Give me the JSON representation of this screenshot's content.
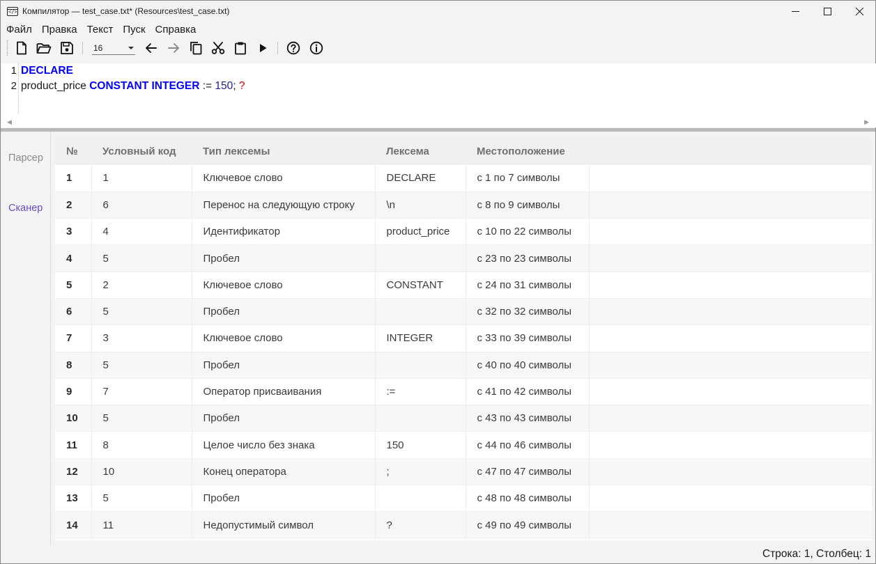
{
  "window": {
    "title": "Компилятор — test_case.txt* (Resources\\test_case.txt)"
  },
  "menu": [
    "Файл",
    "Правка",
    "Текст",
    "Пуск",
    "Справка"
  ],
  "toolbar": {
    "font_size": "16",
    "icons": [
      "new-file-icon",
      "open-folder-icon",
      "save-icon",
      "undo-arrow-icon",
      "redo-arrow-icon",
      "copy-icon",
      "cut-icon",
      "paste-icon",
      "run-icon",
      "help-icon",
      "info-icon"
    ]
  },
  "editor": {
    "line_numbers": [
      "1",
      "2"
    ],
    "line1": {
      "kw": "DECLARE"
    },
    "line2": {
      "ident": "product_price ",
      "kw": "CONSTANT INTEGER",
      "op": " := ",
      "num": "150",
      "semi": "; ",
      "bad": "?"
    }
  },
  "sidetabs": {
    "parser": "Парсер",
    "scanner": "Сканер"
  },
  "table": {
    "headers": [
      "№",
      "Условный код",
      "Тип лексемы",
      "Лексема",
      "Местоположение"
    ],
    "rows": [
      [
        "1",
        "1",
        "Ключевое слово",
        "DECLARE",
        "с 1 по 7 символы"
      ],
      [
        "2",
        "6",
        "Перенос на следующую строку",
        "\\n",
        "с 8 по 9 символы"
      ],
      [
        "3",
        "4",
        "Идентификатор",
        "product_price",
        "с 10 по 22 символы"
      ],
      [
        "4",
        "5",
        "Пробел",
        "",
        "с 23 по 23 символы"
      ],
      [
        "5",
        "2",
        "Ключевое слово",
        "CONSTANT",
        "с 24 по 31 символы"
      ],
      [
        "6",
        "5",
        "Пробел",
        "",
        "с 32 по 32 символы"
      ],
      [
        "7",
        "3",
        "Ключевое слово",
        "INTEGER",
        "с 33 по 39 символы"
      ],
      [
        "8",
        "5",
        "Пробел",
        "",
        "с 40 по 40 символы"
      ],
      [
        "9",
        "7",
        "Оператор присваивания",
        ":=",
        "с 41 по 42 символы"
      ],
      [
        "10",
        "5",
        "Пробел",
        "",
        "с 43 по 43 символы"
      ],
      [
        "11",
        "8",
        "Целое число без знака",
        "150",
        "с 44 по 46 символы"
      ],
      [
        "12",
        "10",
        "Конец оператора",
        ";",
        "с 47 по 47 символы"
      ],
      [
        "13",
        "5",
        "Пробел",
        "",
        "с 48 по 48 символы"
      ],
      [
        "14",
        "11",
        "Недопустимый символ",
        "?",
        "с 49 по 49 символы"
      ]
    ]
  },
  "status": {
    "position": "Строка: 1, Столбец: 1"
  }
}
